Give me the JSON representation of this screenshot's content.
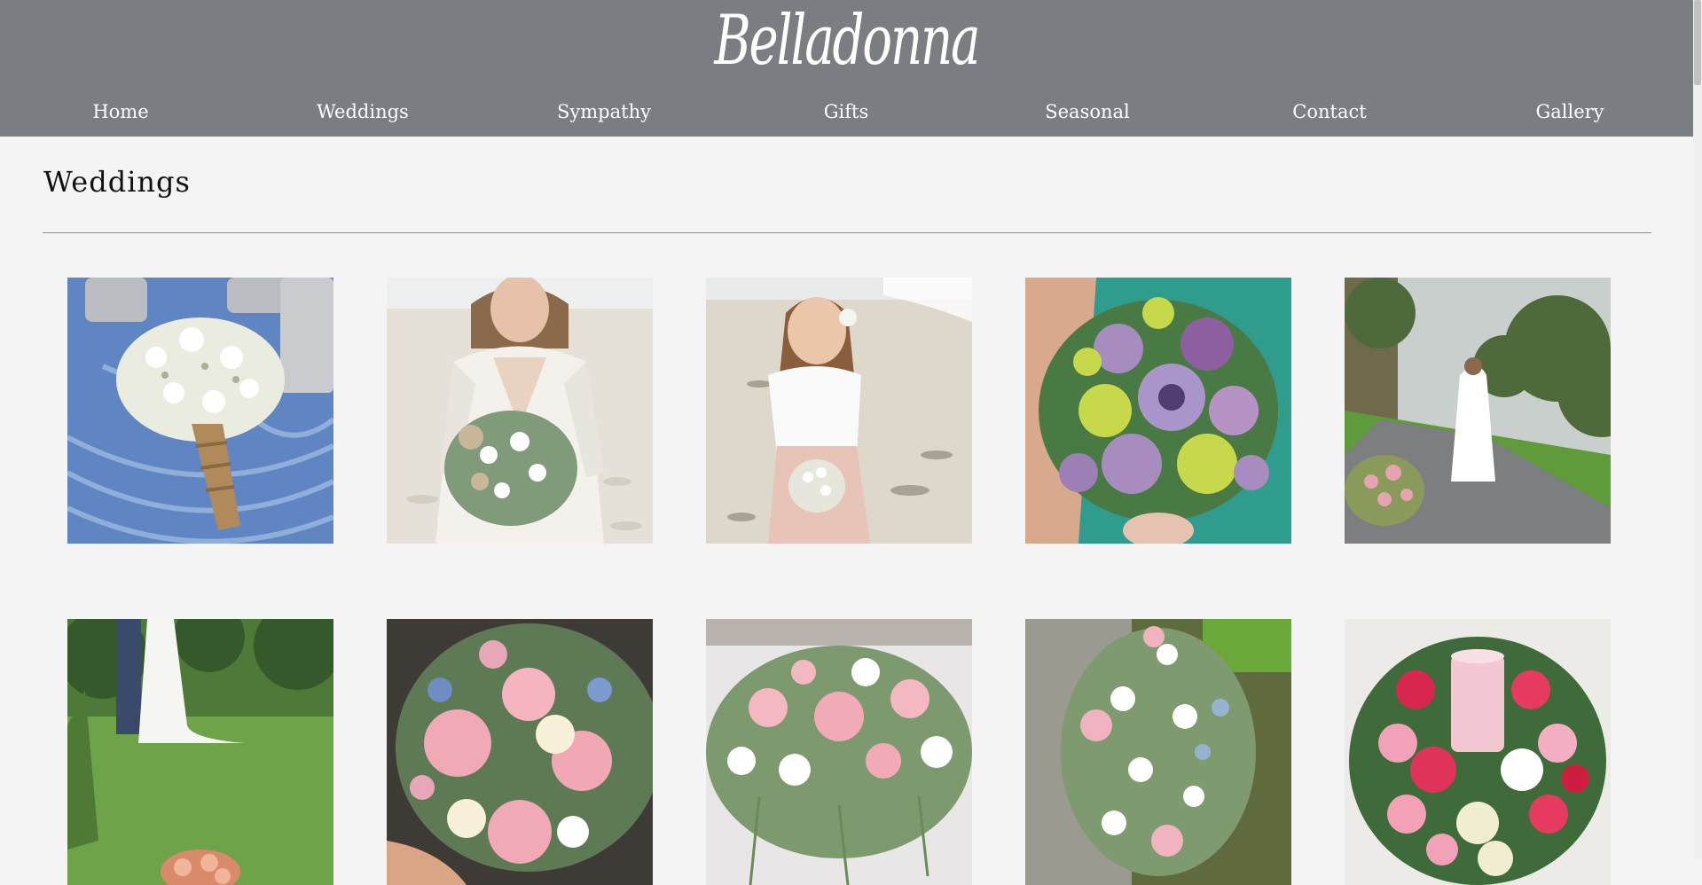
{
  "brand": {
    "name": "Belladonna"
  },
  "nav": {
    "items": [
      {
        "label": "Home"
      },
      {
        "label": "Weddings"
      },
      {
        "label": "Sympathy"
      },
      {
        "label": "Gifts"
      },
      {
        "label": "Seasonal"
      },
      {
        "label": "Contact"
      },
      {
        "label": "Gallery"
      }
    ]
  },
  "page": {
    "title": "Weddings"
  },
  "colors": {
    "header_bg": "#7a7e82",
    "page_bg": "#f4f4f4",
    "nav_text": "#ffffff"
  }
}
